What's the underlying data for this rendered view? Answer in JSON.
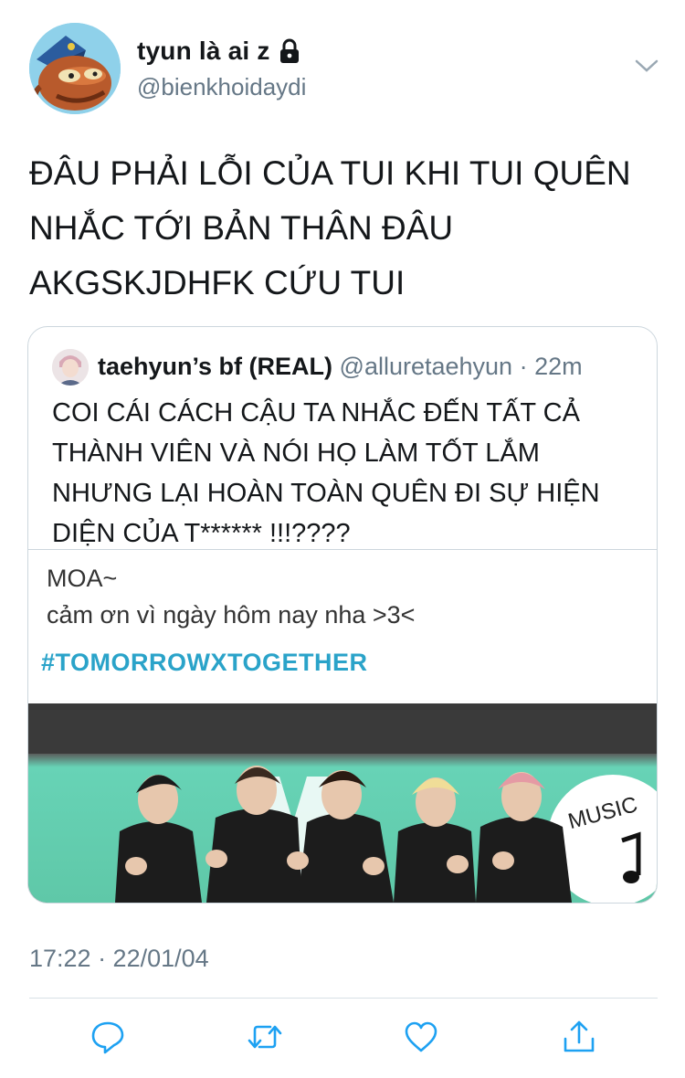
{
  "author": {
    "display_name": "tyun là ai z",
    "handle": "@bienkhoidaydi",
    "avatar_icon": "cartoon-fish-avatar",
    "protected_icon": "lock-icon"
  },
  "tweet": {
    "lines": [
      "ĐÂU PHẢI LỖI CỦA TUI KHI TUI QUÊN",
      "NHẮC TỚI BẢN THÂN ĐÂU",
      "AKGSKJDHFK CỨU TUI"
    ],
    "timestamp": "17:22 · 22/01/04"
  },
  "quoted": {
    "display_name": "taehyun’s bf (REAL)",
    "handle": "@alluretaehyun",
    "separator": "·",
    "age": "22m",
    "lines": [
      "COI CÁI CÁCH CẬU TA NHẮC ĐẾN TẤT CẢ",
      "THÀNH VIÊN VÀ NÓI HỌ LÀM TỐT LẮM",
      "NHƯNG LẠI HOÀN TOÀN QUÊN ĐI SỰ HIỆN",
      "DIỆN CỦA T****** !!!????"
    ],
    "media": {
      "line1": "MOA~",
      "line2": "cảm ơn vì ngày hôm nay nha >3<",
      "hashtag": "#TOMORROWXTOGETHER",
      "photo_text": "MUSIC"
    }
  },
  "actions": [
    {
      "name": "reply",
      "icon": "reply-icon"
    },
    {
      "name": "retweet",
      "icon": "retweet-icon"
    },
    {
      "name": "like",
      "icon": "heart-icon"
    },
    {
      "name": "share",
      "icon": "share-icon"
    }
  ],
  "colors": {
    "text": "#14171a",
    "secondary": "#657786",
    "border": "#ccd6dd",
    "hashtag": "#2aa3c9",
    "icon": "#1da1f2"
  }
}
